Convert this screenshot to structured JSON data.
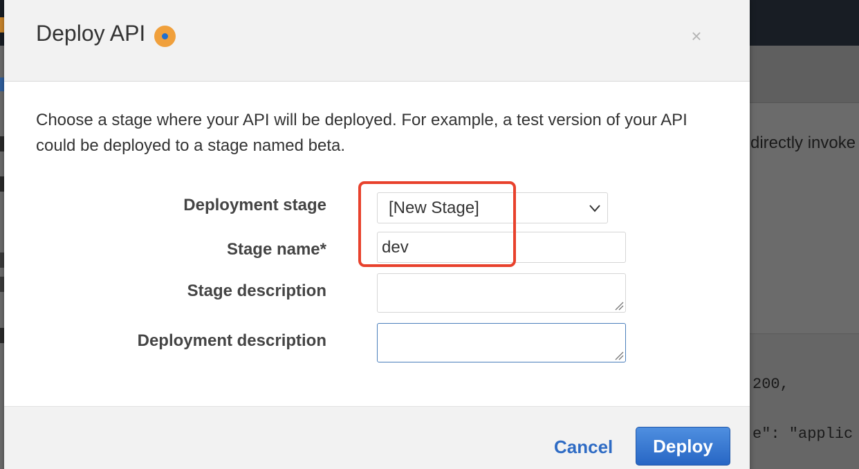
{
  "dialog": {
    "title": "Deploy API",
    "close_symbol": "×",
    "description": "Choose a stage where your API will be deployed. For example, a test version of your API could be deployed to a stage named beta."
  },
  "form": {
    "deployment_stage": {
      "label": "Deployment stage",
      "selected": "[New Stage]"
    },
    "stage_name": {
      "label": "Stage name*",
      "value": "dev"
    },
    "stage_description": {
      "label": "Stage description",
      "value": ""
    },
    "deployment_description": {
      "label": "Deployment description",
      "value": ""
    }
  },
  "footer": {
    "cancel_label": "Cancel",
    "deploy_label": "Deploy"
  },
  "background": {
    "partial_text": "directly invoke",
    "code_line_1": "200,",
    "code_line_2": "e\": \"applic"
  },
  "colors": {
    "accent_blue": "#2e6bc4",
    "highlight_red": "#e8412c",
    "info_orange": "#f0a03c"
  },
  "icons": {
    "info": "info-icon",
    "close": "close-icon",
    "select_arrow": "chevron-down-icon"
  }
}
